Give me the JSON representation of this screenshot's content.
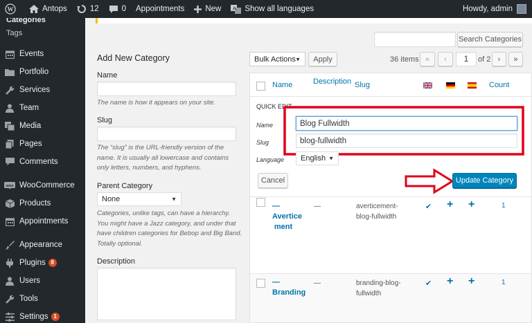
{
  "admin_bar": {
    "site_name": "Antops",
    "updates_count": "12",
    "comments_count": "0",
    "appointments": "Appointments",
    "new": "New",
    "languages": "Show all languages",
    "greeting": "Howdy, admin"
  },
  "sidebar": {
    "submenu": [
      "Categories",
      "Tags"
    ],
    "items": [
      {
        "label": "Events",
        "icon": "calendar-icon"
      },
      {
        "label": "Portfolio",
        "icon": "folder-icon"
      },
      {
        "label": "Services",
        "icon": "wrench-icon"
      },
      {
        "label": "Team",
        "icon": "users-icon"
      },
      {
        "label": "Media",
        "icon": "media-icon"
      },
      {
        "label": "Pages",
        "icon": "pages-icon"
      },
      {
        "label": "Comments",
        "icon": "comment-icon"
      },
      {
        "label": "WooCommerce",
        "icon": "woo-icon"
      },
      {
        "label": "Products",
        "icon": "box-icon"
      },
      {
        "label": "Appointments",
        "icon": "calendar-icon"
      },
      {
        "label": "Appearance",
        "icon": "brush-icon"
      },
      {
        "label": "Plugins",
        "icon": "plug-icon",
        "badge": "8"
      },
      {
        "label": "Users",
        "icon": "user-icon"
      },
      {
        "label": "Tools",
        "icon": "wrench-icon"
      },
      {
        "label": "Settings",
        "icon": "settings-icon",
        "badge": "1"
      }
    ]
  },
  "search": {
    "value": "",
    "button": "Search Categories"
  },
  "add_form": {
    "heading": "Add New Category",
    "name_label": "Name",
    "name_value": "",
    "name_hint": "The name is how it appears on your site.",
    "slug_label": "Slug",
    "slug_value": "",
    "slug_hint_lines": [
      "The “slug” is the URL-friendly version of the",
      "name. It is usually all lowercase and contains",
      "only letters, numbers, and hyphens."
    ],
    "parent_label": "Parent Category",
    "parent_value": "None",
    "parent_hint_lines": [
      "Categories, unlike tags, can have a hierarchy.",
      "You might have a Jazz category, and under that",
      "have children categories for Bebop and Big Band.",
      "Totally optional."
    ],
    "description_label": "Description",
    "description_value": ""
  },
  "toolbar": {
    "bulk_actions": "Bulk Actions",
    "apply": "Apply",
    "items_count": "36 items",
    "first": "«",
    "prev": "‹",
    "page": "1",
    "of_pages": "of 2",
    "next": "›",
    "last": "»"
  },
  "table": {
    "columns": [
      "Name",
      "Description",
      "Slug",
      "Count"
    ],
    "flags": [
      "uk-flag",
      "de-flag",
      "es-flag"
    ],
    "quick_edit": {
      "title": "QUICK EDIT",
      "name_label": "Name",
      "name_value": "Blog Fullwidth",
      "slug_label": "Slug",
      "slug_value": "blog-fullwidth",
      "language_label": "Language",
      "language_value": "English",
      "cancel": "Cancel",
      "update": "Update Category"
    },
    "rows": [
      {
        "name_lines": [
          "—",
          "Avertice",
          "ment"
        ],
        "description": "—",
        "slug_lines": [
          "averticement-",
          "blog-fullwidth"
        ],
        "check": "✔",
        "plus1": "+",
        "plus2": "+",
        "count": "1"
      },
      {
        "name_lines": [
          "—",
          "Branding"
        ],
        "description": "—",
        "slug_lines": [
          "branding-blog-",
          "fullwidth"
        ],
        "check": "✔",
        "plus1": "+",
        "plus2": "+",
        "count": "1"
      }
    ]
  },
  "annotation_color": "#e1001a",
  "accent_color": "#0073aa"
}
